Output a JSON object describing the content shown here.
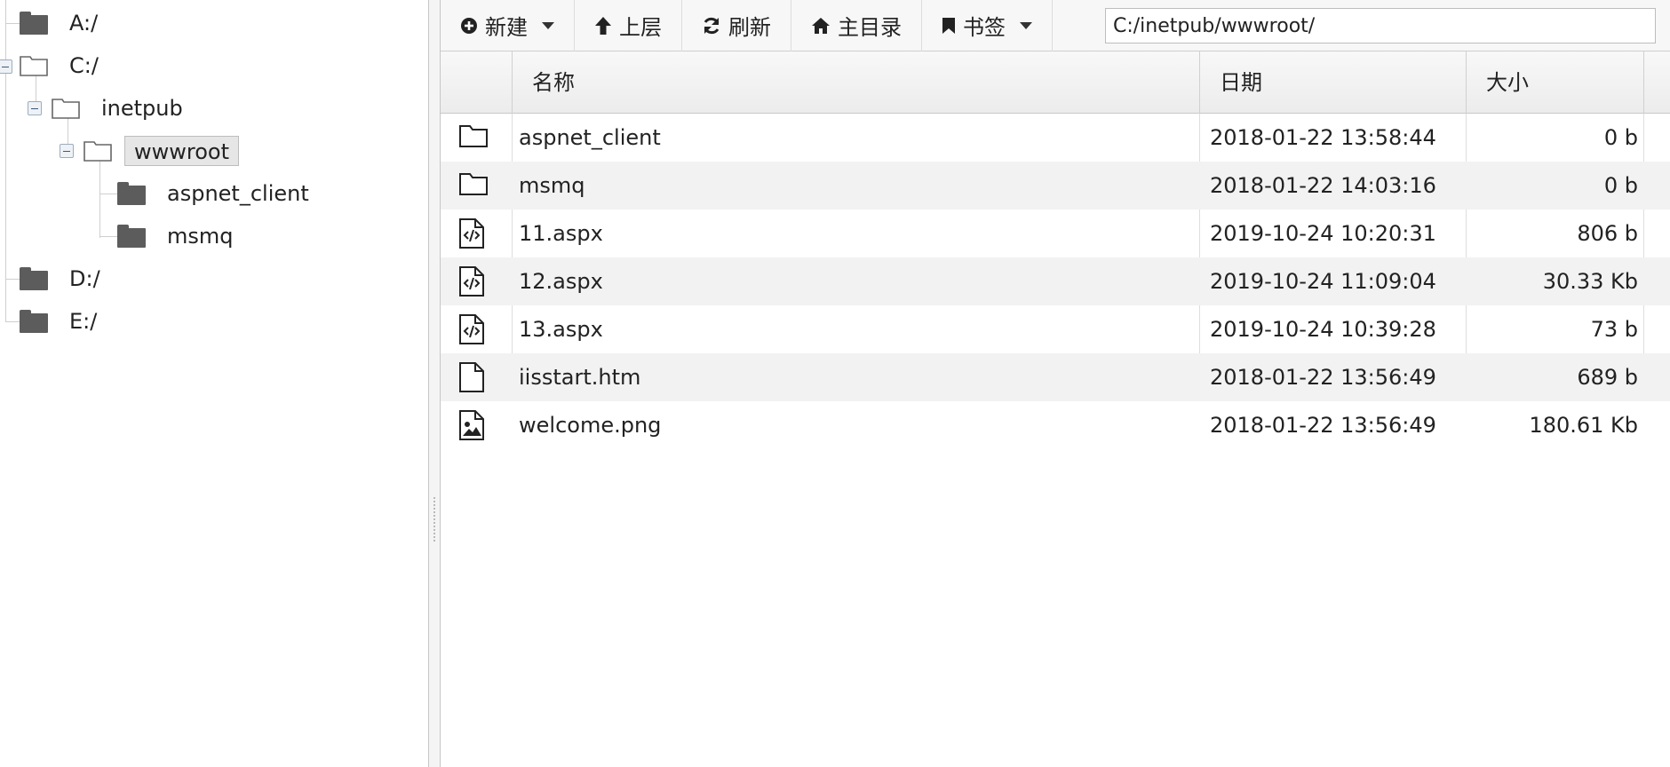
{
  "tree": {
    "items": [
      {
        "label": "A:/"
      },
      {
        "label": "C:/"
      },
      {
        "label": "inetpub"
      },
      {
        "label": "wwwroot"
      },
      {
        "label": "aspnet_client"
      },
      {
        "label": "msmq"
      },
      {
        "label": "D:/"
      },
      {
        "label": "E:/"
      }
    ],
    "selected": "wwwroot"
  },
  "toolbar": {
    "new_label": "新建",
    "up_label": "上层",
    "refresh_label": "刷新",
    "home_label": "主目录",
    "bookmarks_label": "书签",
    "path_value": "C:/inetpub/wwwroot/"
  },
  "grid": {
    "columns": [
      "名称",
      "日期",
      "大小"
    ],
    "rows": [
      {
        "icon": "folder-outline-icon",
        "name": "aspnet_client",
        "date": "2018-01-22 13:58:44",
        "size": "0 b"
      },
      {
        "icon": "folder-outline-icon",
        "name": "msmq",
        "date": "2018-01-22 14:03:16",
        "size": "0 b"
      },
      {
        "icon": "file-code-icon",
        "name": "11.aspx",
        "date": "2019-10-24 10:20:31",
        "size": "806 b"
      },
      {
        "icon": "file-code-icon",
        "name": "12.aspx",
        "date": "2019-10-24 11:09:04",
        "size": "30.33 Kb"
      },
      {
        "icon": "file-code-icon",
        "name": "13.aspx",
        "date": "2019-10-24 10:39:28",
        "size": "73 b"
      },
      {
        "icon": "file-icon",
        "name": "iisstart.htm",
        "date": "2018-01-22 13:56:49",
        "size": "689 b"
      },
      {
        "icon": "file-image-icon",
        "name": "welcome.png",
        "date": "2018-01-22 13:56:49",
        "size": "180.61 Kb"
      }
    ]
  }
}
